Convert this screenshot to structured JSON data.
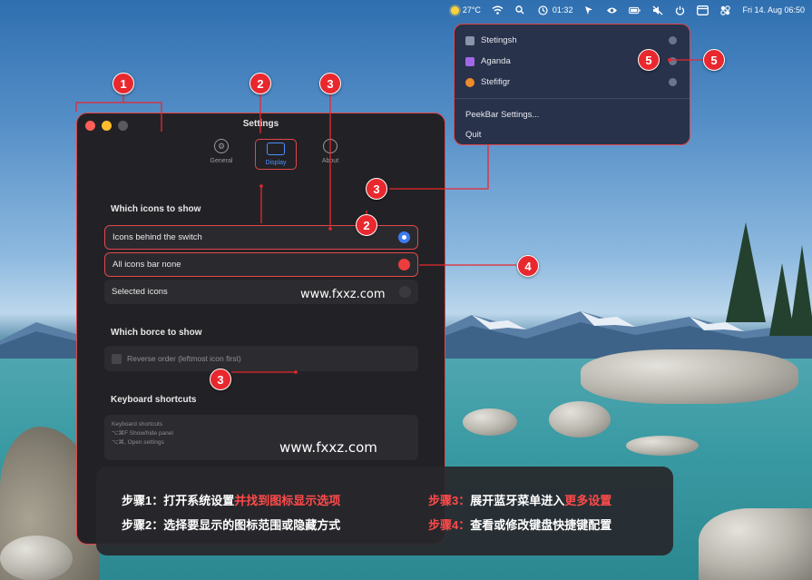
{
  "menubar": {
    "weather": "27°C",
    "clock": "01:32",
    "datetime": "Fri 14. Aug 06:50"
  },
  "settings": {
    "title": "Settings",
    "tabs": [
      {
        "label": "General"
      },
      {
        "label": "Display"
      },
      {
        "label": "About"
      }
    ],
    "section_icons": "Which icons to show",
    "options": [
      {
        "label": "Icons behind the switch"
      },
      {
        "label": "All icons bar none"
      },
      {
        "label": "Selected icons"
      }
    ],
    "section_boxes": "Which borce to show",
    "checkbox_label": "Reverse order (leftmost icon first)",
    "section_shortcuts": "Keyboard shortcuts",
    "shortcuts": [
      "Keyboard shortcuts",
      "⌥⌘F   Show/hide panel",
      "⌥⌘,   Open settings"
    ]
  },
  "menu": {
    "items": [
      {
        "label": "Stetingsh",
        "icon_color": "#8a93a8"
      },
      {
        "label": "Aganda",
        "icon_color": "#a268e8"
      },
      {
        "label": "Stefifigr",
        "icon_color": "#f08a2a"
      }
    ],
    "settings_item": "PeekBar Settings...",
    "quit_item": "Quit"
  },
  "watermarks": [
    "www.fxxz.com",
    "www.fxxz.com"
  ],
  "badges": [
    "1",
    "2",
    "3",
    "3",
    "2",
    "4",
    "5",
    "5",
    "3"
  ],
  "steps": {
    "s1_prefix": "步骤1：打开系统设置",
    "s1_highlight": "并找到图标显示选项",
    "s2": "步骤2：选择要显示的图标范围或隐藏方式",
    "s3_label": "步骤3：",
    "s3_text": "展开蓝牙菜单进入",
    "s3_highlight": "更多设置",
    "s4_label": "步骤4：",
    "s4_text": "查看或修改键盘快捷键配置"
  },
  "colors": {
    "accent_red": "#e8282e",
    "blue_radio": "#3d7bf0"
  }
}
